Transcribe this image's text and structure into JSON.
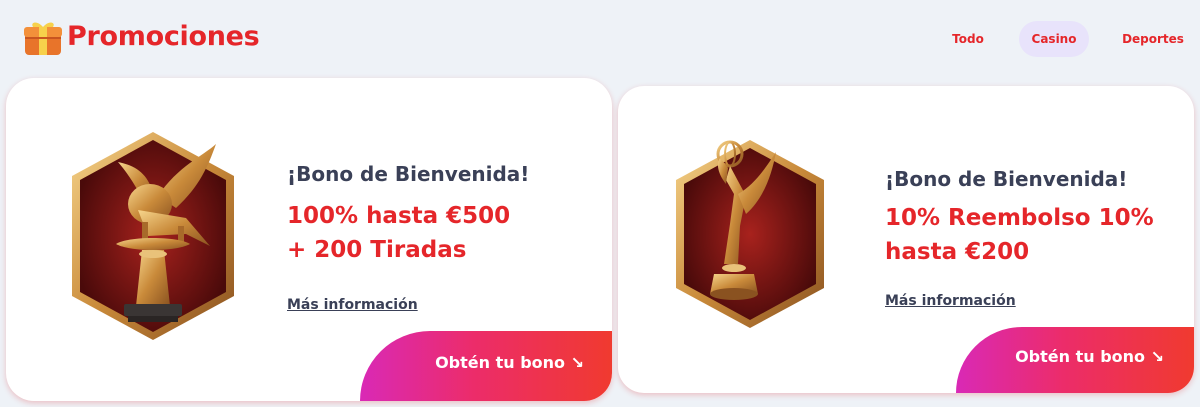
{
  "header": {
    "logo_icon": "gift-box-icon",
    "title": "Promociones",
    "filters": [
      {
        "label": "Todo",
        "active": false
      },
      {
        "label": "Casino",
        "active": true
      },
      {
        "label": "Deportes",
        "active": false
      }
    ]
  },
  "promotions": [
    {
      "badge_icon": "winged-lion-trophy-icon",
      "heading": "¡Bono de Bienvenida!",
      "offer_line1": "100% hasta €500",
      "offer_line2": "+ 200 Tiradas",
      "more_info": "Más información",
      "cta": "Obtén tu bono ↘"
    },
    {
      "badge_icon": "emmy-statuette-trophy-icon",
      "heading": "¡Bono de Bienvenida!",
      "offer_line1": "10% Reembolso 10%",
      "offer_line2": "hasta €200",
      "more_info": "Más información",
      "cta": "Obtén tu bono ↘"
    }
  ],
  "colors": {
    "accent": "#e5262a",
    "text_dark": "#3a4057",
    "active_filter_bg": "#e8e3fb",
    "cta_gradient_start": "#d929b6",
    "cta_gradient_end": "#f03a2f",
    "page_bg": "#eef2f7"
  }
}
